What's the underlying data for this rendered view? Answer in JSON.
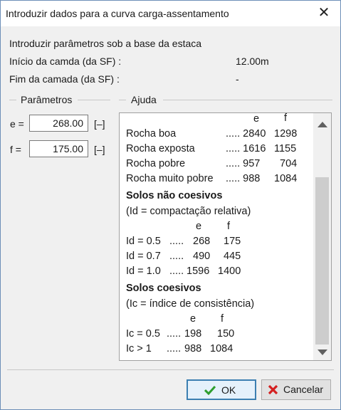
{
  "window": {
    "title": "Introduzir dados para a curva carga-assentamento",
    "close_glyph": "✕"
  },
  "info": {
    "heading": "Introduzir parâmetros sob a base da estaca",
    "start_label": "Início da camda (da SF) :",
    "start_value": "12.00m",
    "end_label": "Fim da camada (da SF) :",
    "end_value": "-"
  },
  "params": {
    "group_title": "Parâmetros",
    "e_label": "e =",
    "e_value": "268.00",
    "e_unit": "[–]",
    "f_label": "f =",
    "f_value": "175.00",
    "f_unit": "[–]"
  },
  "help": {
    "group_title": "Ajuda",
    "rows": [
      {
        "a": "",
        "b": "e",
        "c": "f",
        "kind": "hdr"
      },
      {
        "a": "Rocha boa",
        "b": "..... 2840",
        "c": "1298"
      },
      {
        "a": "Rocha exposta",
        "b": "..... 1616",
        "c": "1155"
      },
      {
        "a": "Rocha pobre",
        "b": "..... 957",
        "c": "704"
      },
      {
        "a": "Rocha muito pobre",
        "b": "..... 988",
        "c": "1084"
      }
    ],
    "cohesionless_title": "Solos não coesivos",
    "cohesionless_note": "(Id = compactação relativa)",
    "cohesionless_hdr_e": "e",
    "cohesionless_hdr_f": "f",
    "cohesionless": [
      {
        "a": "Id = 0.5",
        "dots": ".....",
        "e": "268",
        "f": "175"
      },
      {
        "a": "Id = 0.7",
        "dots": ".....",
        "e": "490",
        "f": "445"
      },
      {
        "a": "Id = 1.0",
        "dots": ".....",
        "e": "1596",
        "f": "1400"
      }
    ],
    "cohesive_title": "Solos coesivos",
    "cohesive_note": "(Ic = índice de consistência)",
    "cohesive_hdr_e": "e",
    "cohesive_hdr_f": "f",
    "cohesive": [
      {
        "a": "Ic = 0.5",
        "dots": ".....",
        "e": "198",
        "f": "150"
      },
      {
        "a": "Ic > 1",
        "dots": ".....",
        "e": "988",
        "f": "1084"
      }
    ]
  },
  "buttons": {
    "ok": "OK",
    "cancel": "Cancelar"
  },
  "colors": {
    "ok_check": "#2e9e2e",
    "cancel_x": "#d42020",
    "default_border": "#3c7fb1"
  }
}
